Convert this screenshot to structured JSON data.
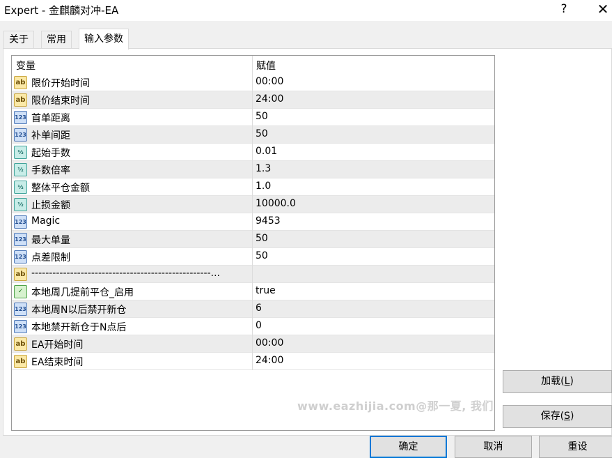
{
  "window": {
    "title": "Expert - 金麒麟对冲-EA",
    "help_glyph": "?",
    "close_glyph": "✕"
  },
  "tabs": [
    {
      "label": "关于",
      "active": false
    },
    {
      "label": "常用",
      "active": false
    },
    {
      "label": "输入参数",
      "active": true
    }
  ],
  "table": {
    "headers": {
      "variable": "变量",
      "value": "赋值"
    },
    "rows": [
      {
        "type": "string",
        "icon_text": "ab",
        "name": "限价开始时间",
        "value": "00:00"
      },
      {
        "type": "string",
        "icon_text": "ab",
        "name": "限价结束时间",
        "value": "24:00"
      },
      {
        "type": "int",
        "icon_text": "123",
        "name": "首单距离",
        "value": "50"
      },
      {
        "type": "int",
        "icon_text": "123",
        "name": "补单间距",
        "value": "50"
      },
      {
        "type": "double",
        "icon_text": "½",
        "name": "起始手数",
        "value": "0.01"
      },
      {
        "type": "double",
        "icon_text": "½",
        "name": "手数倍率",
        "value": "1.3"
      },
      {
        "type": "double",
        "icon_text": "½",
        "name": "整体平仓金额",
        "value": "1.0"
      },
      {
        "type": "double",
        "icon_text": "½",
        "name": "止损金额",
        "value": "10000.0"
      },
      {
        "type": "int",
        "icon_text": "123",
        "name": "Magic",
        "value": "9453"
      },
      {
        "type": "int",
        "icon_text": "123",
        "name": "最大单量",
        "value": "50"
      },
      {
        "type": "int",
        "icon_text": "123",
        "name": "点差限制",
        "value": "50"
      },
      {
        "type": "string",
        "icon_text": "ab",
        "name": "---------------------------------------------------...",
        "value": ""
      },
      {
        "type": "bool",
        "icon_text": "✓",
        "name": "本地周几提前平仓_启用",
        "value": "true"
      },
      {
        "type": "int",
        "icon_text": "123",
        "name": "本地周N以后禁开新仓",
        "value": "6"
      },
      {
        "type": "int",
        "icon_text": "123",
        "name": "本地禁开新仓于N点后",
        "value": "0"
      },
      {
        "type": "string",
        "icon_text": "ab",
        "name": "EA开始时间",
        "value": "00:00"
      },
      {
        "type": "string",
        "icon_text": "ab",
        "name": "EA结束时间",
        "value": "24:00"
      }
    ]
  },
  "buttons": {
    "load": {
      "label": "加载(",
      "key": "L",
      "suffix": ")"
    },
    "save": {
      "label": "保存(",
      "key": "S",
      "suffix": ")"
    },
    "ok": "确定",
    "cancel": "取消",
    "reset": "重设"
  },
  "watermark": "www.eazhijia.com@那一夏, 我们"
}
